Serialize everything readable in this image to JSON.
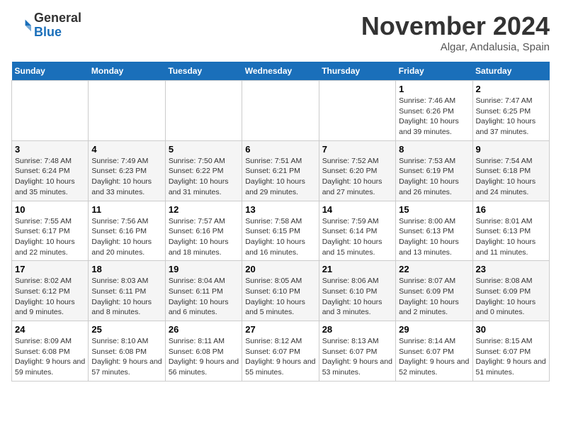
{
  "header": {
    "logo_general": "General",
    "logo_blue": "Blue",
    "month_title": "November 2024",
    "location": "Algar, Andalusia, Spain"
  },
  "weekdays": [
    "Sunday",
    "Monday",
    "Tuesday",
    "Wednesday",
    "Thursday",
    "Friday",
    "Saturday"
  ],
  "weeks": [
    [
      {
        "day": "",
        "info": ""
      },
      {
        "day": "",
        "info": ""
      },
      {
        "day": "",
        "info": ""
      },
      {
        "day": "",
        "info": ""
      },
      {
        "day": "",
        "info": ""
      },
      {
        "day": "1",
        "info": "Sunrise: 7:46 AM\nSunset: 6:26 PM\nDaylight: 10 hours and 39 minutes."
      },
      {
        "day": "2",
        "info": "Sunrise: 7:47 AM\nSunset: 6:25 PM\nDaylight: 10 hours and 37 minutes."
      }
    ],
    [
      {
        "day": "3",
        "info": "Sunrise: 7:48 AM\nSunset: 6:24 PM\nDaylight: 10 hours and 35 minutes."
      },
      {
        "day": "4",
        "info": "Sunrise: 7:49 AM\nSunset: 6:23 PM\nDaylight: 10 hours and 33 minutes."
      },
      {
        "day": "5",
        "info": "Sunrise: 7:50 AM\nSunset: 6:22 PM\nDaylight: 10 hours and 31 minutes."
      },
      {
        "day": "6",
        "info": "Sunrise: 7:51 AM\nSunset: 6:21 PM\nDaylight: 10 hours and 29 minutes."
      },
      {
        "day": "7",
        "info": "Sunrise: 7:52 AM\nSunset: 6:20 PM\nDaylight: 10 hours and 27 minutes."
      },
      {
        "day": "8",
        "info": "Sunrise: 7:53 AM\nSunset: 6:19 PM\nDaylight: 10 hours and 26 minutes."
      },
      {
        "day": "9",
        "info": "Sunrise: 7:54 AM\nSunset: 6:18 PM\nDaylight: 10 hours and 24 minutes."
      }
    ],
    [
      {
        "day": "10",
        "info": "Sunrise: 7:55 AM\nSunset: 6:17 PM\nDaylight: 10 hours and 22 minutes."
      },
      {
        "day": "11",
        "info": "Sunrise: 7:56 AM\nSunset: 6:16 PM\nDaylight: 10 hours and 20 minutes."
      },
      {
        "day": "12",
        "info": "Sunrise: 7:57 AM\nSunset: 6:16 PM\nDaylight: 10 hours and 18 minutes."
      },
      {
        "day": "13",
        "info": "Sunrise: 7:58 AM\nSunset: 6:15 PM\nDaylight: 10 hours and 16 minutes."
      },
      {
        "day": "14",
        "info": "Sunrise: 7:59 AM\nSunset: 6:14 PM\nDaylight: 10 hours and 15 minutes."
      },
      {
        "day": "15",
        "info": "Sunrise: 8:00 AM\nSunset: 6:13 PM\nDaylight: 10 hours and 13 minutes."
      },
      {
        "day": "16",
        "info": "Sunrise: 8:01 AM\nSunset: 6:13 PM\nDaylight: 10 hours and 11 minutes."
      }
    ],
    [
      {
        "day": "17",
        "info": "Sunrise: 8:02 AM\nSunset: 6:12 PM\nDaylight: 10 hours and 9 minutes."
      },
      {
        "day": "18",
        "info": "Sunrise: 8:03 AM\nSunset: 6:11 PM\nDaylight: 10 hours and 8 minutes."
      },
      {
        "day": "19",
        "info": "Sunrise: 8:04 AM\nSunset: 6:11 PM\nDaylight: 10 hours and 6 minutes."
      },
      {
        "day": "20",
        "info": "Sunrise: 8:05 AM\nSunset: 6:10 PM\nDaylight: 10 hours and 5 minutes."
      },
      {
        "day": "21",
        "info": "Sunrise: 8:06 AM\nSunset: 6:10 PM\nDaylight: 10 hours and 3 minutes."
      },
      {
        "day": "22",
        "info": "Sunrise: 8:07 AM\nSunset: 6:09 PM\nDaylight: 10 hours and 2 minutes."
      },
      {
        "day": "23",
        "info": "Sunrise: 8:08 AM\nSunset: 6:09 PM\nDaylight: 10 hours and 0 minutes."
      }
    ],
    [
      {
        "day": "24",
        "info": "Sunrise: 8:09 AM\nSunset: 6:08 PM\nDaylight: 9 hours and 59 minutes."
      },
      {
        "day": "25",
        "info": "Sunrise: 8:10 AM\nSunset: 6:08 PM\nDaylight: 9 hours and 57 minutes."
      },
      {
        "day": "26",
        "info": "Sunrise: 8:11 AM\nSunset: 6:08 PM\nDaylight: 9 hours and 56 minutes."
      },
      {
        "day": "27",
        "info": "Sunrise: 8:12 AM\nSunset: 6:07 PM\nDaylight: 9 hours and 55 minutes."
      },
      {
        "day": "28",
        "info": "Sunrise: 8:13 AM\nSunset: 6:07 PM\nDaylight: 9 hours and 53 minutes."
      },
      {
        "day": "29",
        "info": "Sunrise: 8:14 AM\nSunset: 6:07 PM\nDaylight: 9 hours and 52 minutes."
      },
      {
        "day": "30",
        "info": "Sunrise: 8:15 AM\nSunset: 6:07 PM\nDaylight: 9 hours and 51 minutes."
      }
    ]
  ]
}
